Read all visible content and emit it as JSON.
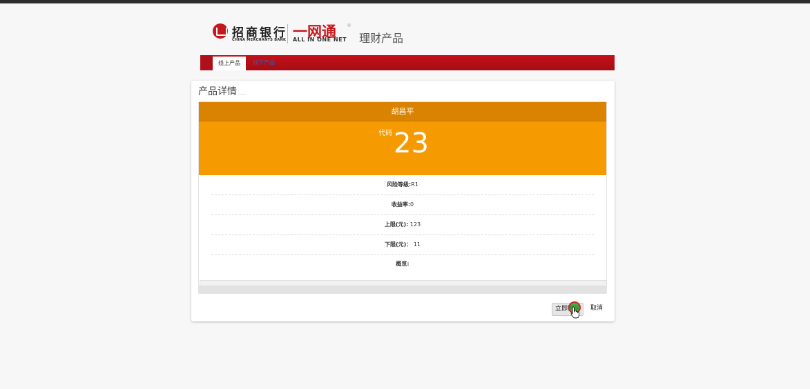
{
  "header": {
    "bank_name": "招商银行",
    "bank_name_en": "CHINA MERCHANTS BANK",
    "brand_cn": "一网通",
    "brand_en": "ALL IN ONE NET",
    "registered_mark": "®",
    "section_title": "理财产品"
  },
  "nav": {
    "tabs": [
      {
        "label": "线上产品",
        "active": true
      },
      {
        "label": "线下产品",
        "active": false
      }
    ]
  },
  "panel": {
    "title": "产品详情",
    "product_name": "胡昌平",
    "code_label": "代码",
    "code_value": "23",
    "rows": [
      {
        "label": "风险等级:",
        "value": "R1"
      },
      {
        "label": "收益率:",
        "value": "0"
      },
      {
        "label": "上限(元):",
        "value": " 123"
      },
      {
        "label": "下限(元)：",
        "value": " 11"
      },
      {
        "label": "概览:",
        "value": ""
      }
    ]
  },
  "actions": {
    "buy_label": "立即购买",
    "cancel_label": "取消"
  },
  "colors": {
    "brand_red": "#c4101a",
    "card_head": "#d98300",
    "card_orange": "#f59a00"
  }
}
